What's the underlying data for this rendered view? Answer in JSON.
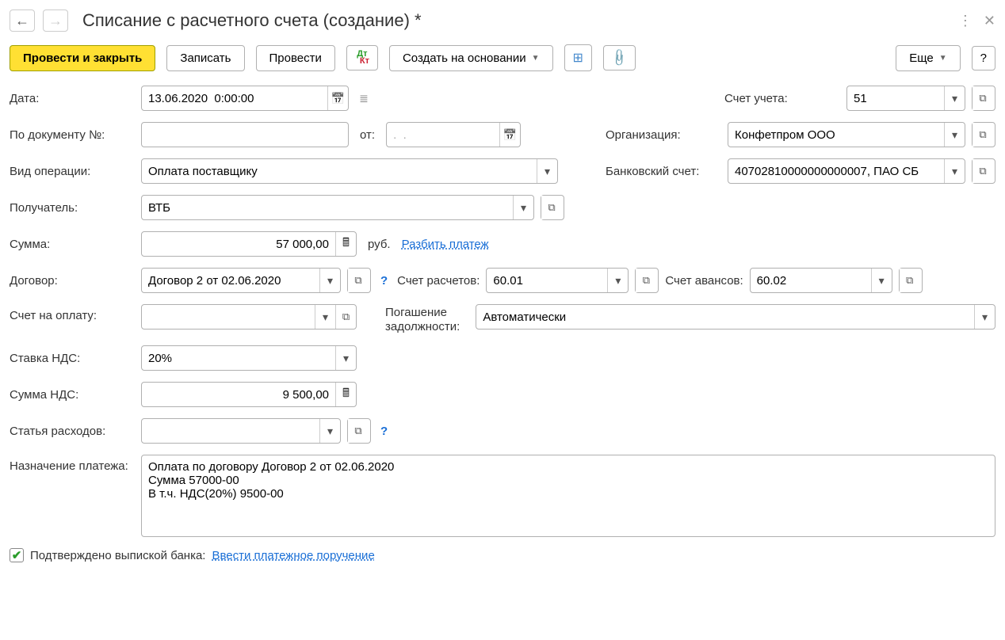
{
  "header": {
    "title": "Списание с расчетного счета (создание) *"
  },
  "toolbar": {
    "post_close": "Провести и закрыть",
    "save": "Записать",
    "post": "Провести",
    "create_based": "Создать на основании",
    "more": "Еще",
    "help": "?"
  },
  "labels": {
    "date": "Дата:",
    "account": "Счет учета:",
    "by_doc": "По документу №:",
    "from": "от:",
    "org": "Организация:",
    "op_type": "Вид операции:",
    "bank_acc": "Банковский счет:",
    "payee": "Получатель:",
    "amount": "Сумма:",
    "currency": "руб.",
    "split": "Разбить платеж",
    "contract": "Договор:",
    "settle_acc": "Счет расчетов:",
    "advance_acc": "Счет авансов:",
    "invoice": "Счет на оплату:",
    "debt_repay1": "Погашение",
    "debt_repay2": "задолжности:",
    "vat_rate": "Ставка НДС:",
    "vat_sum": "Сумма НДС:",
    "expense": "Статья расходов:",
    "purpose": "Назначение платежа:",
    "confirmed": "Подтверждено выпиской банка:",
    "enter_order": "Ввести платежное поручение"
  },
  "values": {
    "date": "13.06.2020  0:00:00",
    "account": "51",
    "doc_no": "",
    "from_date": ".  .",
    "org": "Конфетпром ООО",
    "op_type": "Оплата поставщику",
    "bank_acc": "40702810000000000007, ПАО СБ",
    "payee": "ВТБ",
    "amount": "57 000,00",
    "contract": "Договор 2 от 02.06.2020",
    "settle_acc": "60.01",
    "advance_acc": "60.02",
    "invoice": "",
    "debt_repay": "Автоматически",
    "vat_rate": "20%",
    "vat_sum": "9 500,00",
    "expense": "",
    "purpose": "Оплата по договору Договор 2 от 02.06.2020\nСумма 57000-00\nВ т.ч. НДС(20%) 9500-00",
    "confirmed": true
  }
}
